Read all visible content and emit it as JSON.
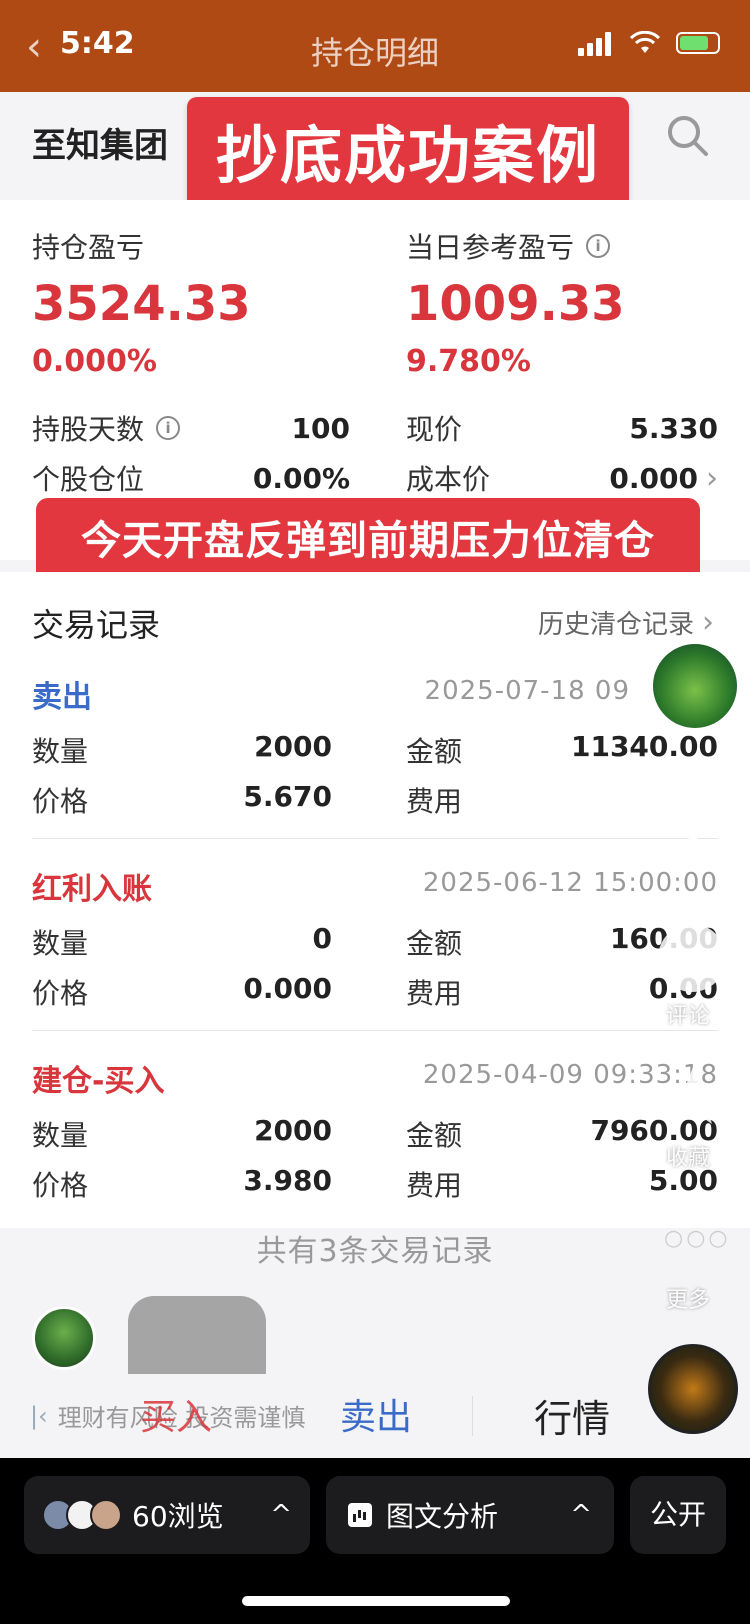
{
  "status_bar": {
    "time": "5:42",
    "title": "持仓明细",
    "back_icon": "chevron-left-icon",
    "icons": [
      "signal-icon",
      "wifi-icon",
      "battery-icon"
    ]
  },
  "header": {
    "company": "至知集团",
    "search_icon": "search-icon",
    "promo_title": "抄底成功案例"
  },
  "summary": {
    "holding_pl_label": "持仓盈亏",
    "holding_pl_value": "3524.33",
    "holding_pl_pct": "0.000%",
    "daily_pl_label": "当日参考盈亏",
    "daily_pl_value": "1009.33",
    "daily_pl_pct": "9.780%",
    "hold_days_label": "持股天数",
    "hold_days_value": "100",
    "current_price_label": "现价",
    "current_price_value": "5.330",
    "position_label": "个股仓位",
    "position_value": "0.00%",
    "cost_label": "成本价",
    "cost_value": "0.000",
    "promo_caption": "今天开盘反弹到前期压力位清仓"
  },
  "records": {
    "title": "交易记录",
    "history_link": "历史清仓记录",
    "trades": [
      {
        "type": "卖出",
        "type_color": "#3a6bc8",
        "time": "2025-07-18 09",
        "qty_label": "数量",
        "qty": "2000",
        "amount_label": "金额",
        "amount": "11340.00",
        "price_label": "价格",
        "price": "5.670",
        "fee_label": "费用",
        "fee": ""
      },
      {
        "type": "红利入账",
        "type_color": "#d8363c",
        "time": "2025-06-12 15:00:00",
        "qty_label": "数量",
        "qty": "0",
        "amount_label": "金额",
        "amount": "160.00",
        "price_label": "价格",
        "price": "0.000",
        "fee_label": "费用",
        "fee": "0.00"
      },
      {
        "type": "建仓-买入",
        "type_color": "#d8363c",
        "time": "2025-04-09 09:33:18",
        "qty_label": "数量",
        "qty": "2000",
        "amount_label": "金额",
        "amount": "7960.00",
        "price_label": "价格",
        "price": "3.980",
        "fee_label": "费用",
        "fee": "5.00"
      }
    ],
    "count_text": "共有3条交易记录"
  },
  "trade_bar": {
    "disclaimer": "理财有风险 投资需谨慎",
    "buy": "买入",
    "sell": "卖出",
    "market": "行情"
  },
  "rail": {
    "comment_label": "评论",
    "star_label": "收藏",
    "more_label": "更多"
  },
  "bottom_nav": {
    "views": "60浏览",
    "analysis": "图文分析",
    "public": "公开"
  },
  "colors": {
    "status_bar_bg": "#b04a14",
    "accent_red": "#d8363c",
    "promo_red": "#e2373f",
    "sell_blue": "#3a6bc8"
  }
}
